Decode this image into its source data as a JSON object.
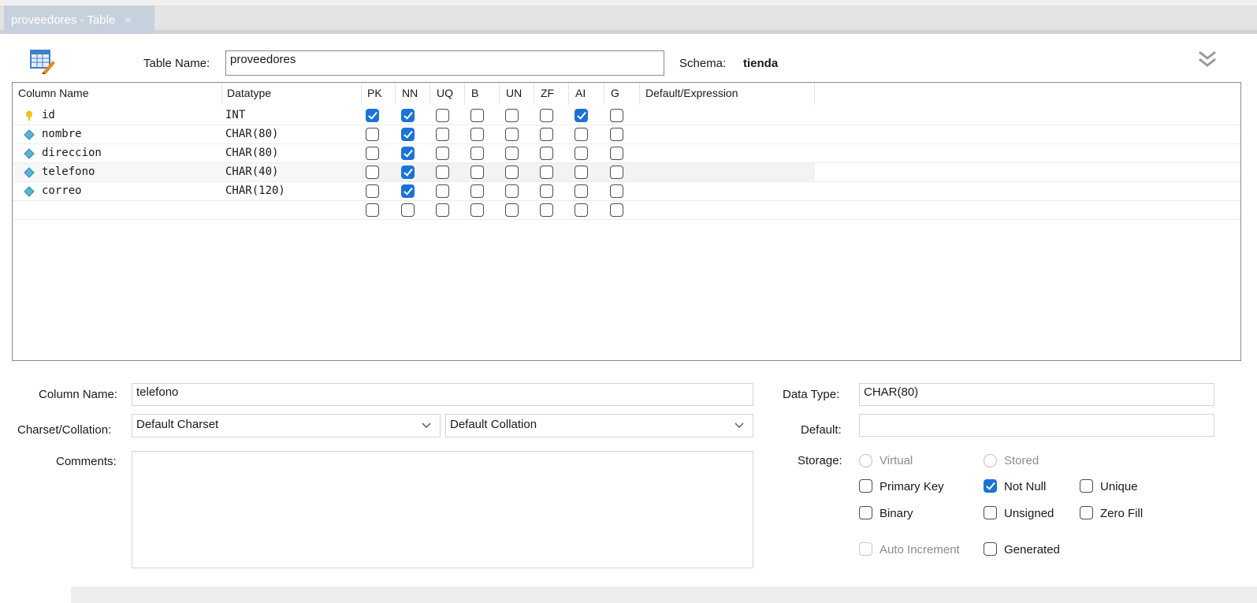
{
  "tab": {
    "title": "proveedores - Table",
    "close_glyph": "×"
  },
  "header": {
    "table_name_label": "Table Name:",
    "table_name_value": "proveedores",
    "schema_label": "Schema:",
    "schema_value": "tienda"
  },
  "columns_grid": {
    "headers": [
      "Column Name",
      "Datatype",
      "PK",
      "NN",
      "UQ",
      "B",
      "UN",
      "ZF",
      "AI",
      "G",
      "Default/Expression"
    ],
    "rows": [
      {
        "name": "id",
        "datatype": "INT",
        "icon": "key-icon",
        "flags": {
          "PK": true,
          "NN": true,
          "UQ": false,
          "B": false,
          "UN": false,
          "ZF": false,
          "AI": true,
          "G": false
        },
        "default": ""
      },
      {
        "name": "nombre",
        "datatype": "CHAR(80)",
        "icon": "column-diamond-icon",
        "flags": {
          "PK": false,
          "NN": true,
          "UQ": false,
          "B": false,
          "UN": false,
          "ZF": false,
          "AI": false,
          "G": false
        },
        "default": ""
      },
      {
        "name": "direccion",
        "datatype": "CHAR(80)",
        "icon": "column-diamond-icon",
        "flags": {
          "PK": false,
          "NN": true,
          "UQ": false,
          "B": false,
          "UN": false,
          "ZF": false,
          "AI": false,
          "G": false
        },
        "default": ""
      },
      {
        "name": "telefono",
        "datatype": "CHAR(40)",
        "icon": "column-diamond-icon",
        "flags": {
          "PK": false,
          "NN": true,
          "UQ": false,
          "B": false,
          "UN": false,
          "ZF": false,
          "AI": false,
          "G": false
        },
        "default": ""
      },
      {
        "name": "correo",
        "datatype": "CHAR(120)",
        "icon": "column-diamond-icon",
        "flags": {
          "PK": false,
          "NN": true,
          "UQ": false,
          "B": false,
          "UN": false,
          "ZF": false,
          "AI": false,
          "G": false
        },
        "default": ""
      },
      {
        "name": "",
        "datatype": "",
        "icon": "",
        "flags": {
          "PK": false,
          "NN": false,
          "UQ": false,
          "B": false,
          "UN": false,
          "ZF": false,
          "AI": false,
          "G": false
        },
        "default": ""
      }
    ]
  },
  "details": {
    "column_name_label": "Column Name:",
    "column_name_value": "telefono",
    "charset_label": "Charset/Collation:",
    "charset_value": "Default Charset",
    "collation_value": "Default Collation",
    "comments_label": "Comments:",
    "comments_value": "",
    "data_type_label": "Data Type:",
    "data_type_value": "CHAR(80)",
    "default_label": "Default:",
    "default_value": "",
    "storage_label": "Storage:",
    "storage_options": [
      "Virtual",
      "Stored"
    ],
    "flags": [
      {
        "label": "Primary Key",
        "checked": false,
        "enabled": true
      },
      {
        "label": "Not Null",
        "checked": true,
        "enabled": true
      },
      {
        "label": "Unique",
        "checked": false,
        "enabled": true
      },
      {
        "label": "Binary",
        "checked": false,
        "enabled": true
      },
      {
        "label": "Unsigned",
        "checked": false,
        "enabled": true
      },
      {
        "label": "Zero Fill",
        "checked": false,
        "enabled": true
      },
      {
        "label": "Auto Increment",
        "checked": false,
        "enabled": false
      },
      {
        "label": "Generated",
        "checked": false,
        "enabled": true
      }
    ]
  },
  "colors": {
    "accent": "#1a73d6",
    "tab_bg": "#c7d1dd",
    "key_icon": "#f2c21b",
    "diamond_icon": "#5ab4d6"
  }
}
